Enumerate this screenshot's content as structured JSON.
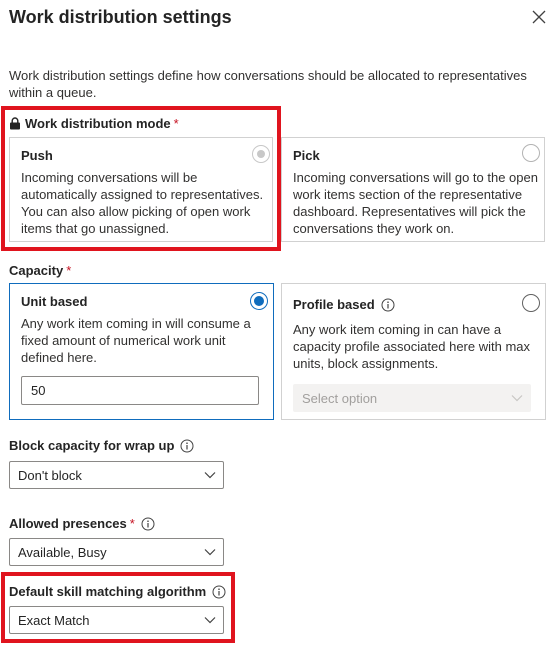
{
  "panel": {
    "title": "Work distribution settings",
    "description": "Work distribution settings define how conversations should be allocated to representatives within a queue."
  },
  "work_distribution_mode": {
    "label": "Work distribution mode",
    "required_mark": "*",
    "options": [
      {
        "title": "Push",
        "description": "Incoming conversations will be automatically assigned to representatives. You can also allow picking of open work items that go unassigned.",
        "selected": true
      },
      {
        "title": "Pick",
        "description": "Incoming conversations will go to the open work items section of the representative dashboard. Representatives will pick the conversations they work on.",
        "selected": false
      }
    ]
  },
  "capacity": {
    "label": "Capacity",
    "required_mark": "*",
    "options": [
      {
        "title": "Unit based",
        "description": "Any work item coming in will consume a fixed amount of numerical work unit defined here.",
        "value": "50",
        "selected": true
      },
      {
        "title": "Profile based",
        "description": "Any work item coming in can have a capacity profile associated here with max units, block assignments.",
        "select_placeholder": "Select option",
        "selected": false
      }
    ]
  },
  "block_capacity": {
    "label": "Block capacity for wrap up",
    "value": "Don't block"
  },
  "allowed_presences": {
    "label": "Allowed presences",
    "required_mark": "*",
    "value": "Available, Busy"
  },
  "skill_matching": {
    "label": "Default skill matching algorithm",
    "value": "Exact Match"
  },
  "colors": {
    "accent": "#0f6cbd",
    "required": "#c50f1f",
    "highlight": "#e0141e"
  },
  "icons": [
    "close-icon",
    "lock-icon",
    "info-icon",
    "chevron-down-icon"
  ]
}
